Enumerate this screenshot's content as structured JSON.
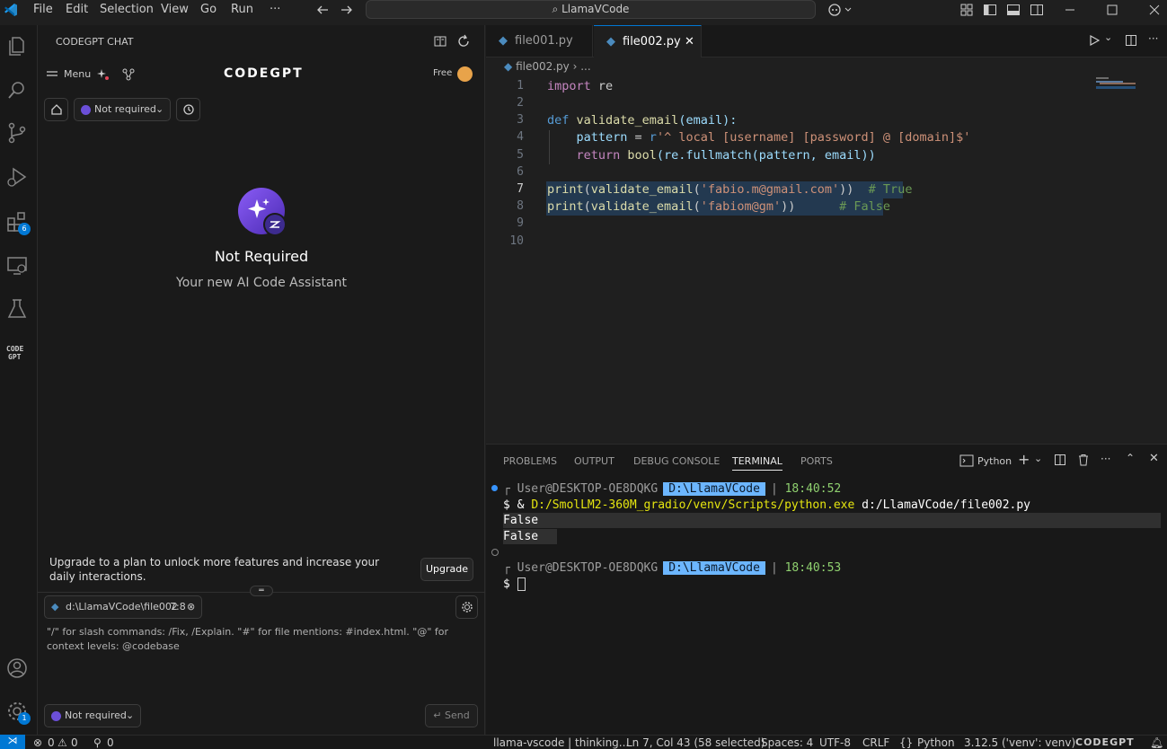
{
  "menu": {
    "file": "File",
    "edit": "Edit",
    "selection": "Selection",
    "view": "View",
    "go": "Go",
    "run": "Run",
    "more": "···"
  },
  "search": {
    "label": "LlamaVCode"
  },
  "activity": {
    "extensions_badge": "6",
    "settings_badge": "1"
  },
  "sidebar": {
    "title": "CODEGPT CHAT",
    "menu_label": "Menu",
    "brand": "CODEGPT",
    "plan": "Free",
    "agent_select": "Not required",
    "hero_title": "Not Required",
    "hero_subtitle": "Your new AI Code Assistant",
    "upgrade_text": "Upgrade to a plan to unlock more features and increase your daily interactions.",
    "upgrade_button": "Upgrade",
    "context_file": "d:\\LlamaVCode\\file002",
    "context_lines": "7:8",
    "input_hint": "\"/\" for slash commands: /Fix, /Explain. \"#\" for file mentions: #index.html. \"@\" for context levels: @codebase",
    "bottom_select": "Not required",
    "send_button": "Send"
  },
  "editor": {
    "tabs": [
      {
        "label": "file001.py"
      },
      {
        "label": "file002.py"
      }
    ],
    "breadcrumb": "file002.py",
    "breadcrumb_more": "...",
    "line_numbers": [
      "1",
      "2",
      "3",
      "4",
      "5",
      "6",
      "7",
      "8",
      "9",
      "10"
    ],
    "code": {
      "l1_kw": "import",
      "l1_mod": " re",
      "l3_def": "def",
      "l3_fn": " validate_email",
      "l3_rest": "(email):",
      "l4_var": "    pattern",
      "l4_eq": " = ",
      "l4_r": "r",
      "l4_str": "'^ local [username] [password] @ [domain]$'",
      "l5_kw": "    return",
      "l5_fn": " bool",
      "l5_rest": "(re.fullmatch(pattern, email))",
      "l7_print": "print",
      "l7_mid": "(",
      "l7_fn": "validate_email",
      "l7_open": "(",
      "l7_str": "'fabio.m@gmail.com'",
      "l7_close": "))",
      "l7_cm": "  # True",
      "l8_print": "print",
      "l8_mid": "(",
      "l8_fn": "validate_email",
      "l8_open": "(",
      "l8_str": "'fabiom@gm'",
      "l8_close": "))",
      "l8_cm": "      # False"
    }
  },
  "panel": {
    "tabs": [
      "PROBLEMS",
      "OUTPUT",
      "DEBUG CONSOLE",
      "TERMINAL",
      "PORTS"
    ],
    "shell": "Python",
    "prompt_user": "User@DESKTOP-OE8DQKG",
    "prompt_path": "D:\\LlamaVCode",
    "time1": "18:40:52",
    "time2": "18:40:53",
    "command_prefix": "$ & ",
    "command_exe": "D:/SmolLM2-360M_gradio/venv/Scripts/python.exe",
    "command_arg": " d:/LlamaVCode/file002.py",
    "output1": "False",
    "output2": "False",
    "prompt_end": "$"
  },
  "status": {
    "errors": "0",
    "warnings": "0",
    "ports": "0",
    "llama": "llama-vscode | thinking...",
    "cursor": "Ln 7, Col 43 (58 selected)",
    "spaces": "Spaces: 4",
    "encoding": "UTF-8",
    "eol": "CRLF",
    "language": "Python",
    "interpreter": "3.12.5 ('venv': venv)",
    "brand": "CODEGPT"
  }
}
